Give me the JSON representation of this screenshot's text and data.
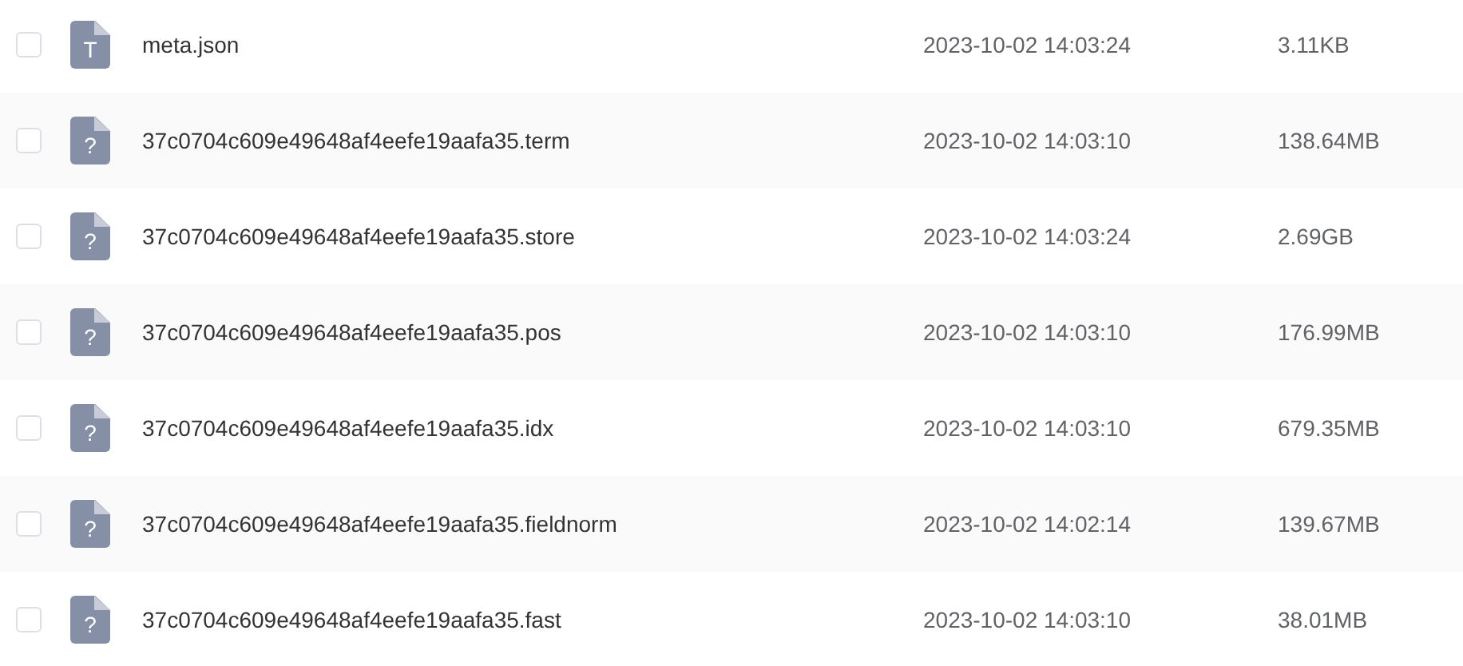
{
  "files": [
    {
      "icon_letter": "T",
      "name": "meta.json",
      "modified": "2023-10-02 14:03:24",
      "size": "3.11KB",
      "checked": false
    },
    {
      "icon_letter": "?",
      "name": "37c0704c609e49648af4eefe19aafa35.term",
      "modified": "2023-10-02 14:03:10",
      "size": "138.64MB",
      "checked": false
    },
    {
      "icon_letter": "?",
      "name": "37c0704c609e49648af4eefe19aafa35.store",
      "modified": "2023-10-02 14:03:24",
      "size": "2.69GB",
      "checked": false
    },
    {
      "icon_letter": "?",
      "name": "37c0704c609e49648af4eefe19aafa35.pos",
      "modified": "2023-10-02 14:03:10",
      "size": "176.99MB",
      "checked": false
    },
    {
      "icon_letter": "?",
      "name": "37c0704c609e49648af4eefe19aafa35.idx",
      "modified": "2023-10-02 14:03:10",
      "size": "679.35MB",
      "checked": false
    },
    {
      "icon_letter": "?",
      "name": "37c0704c609e49648af4eefe19aafa35.fieldnorm",
      "modified": "2023-10-02 14:02:14",
      "size": "139.67MB",
      "checked": false
    },
    {
      "icon_letter": "?",
      "name": "37c0704c609e49648af4eefe19aafa35.fast",
      "modified": "2023-10-02 14:03:10",
      "size": "38.01MB",
      "checked": false
    }
  ]
}
